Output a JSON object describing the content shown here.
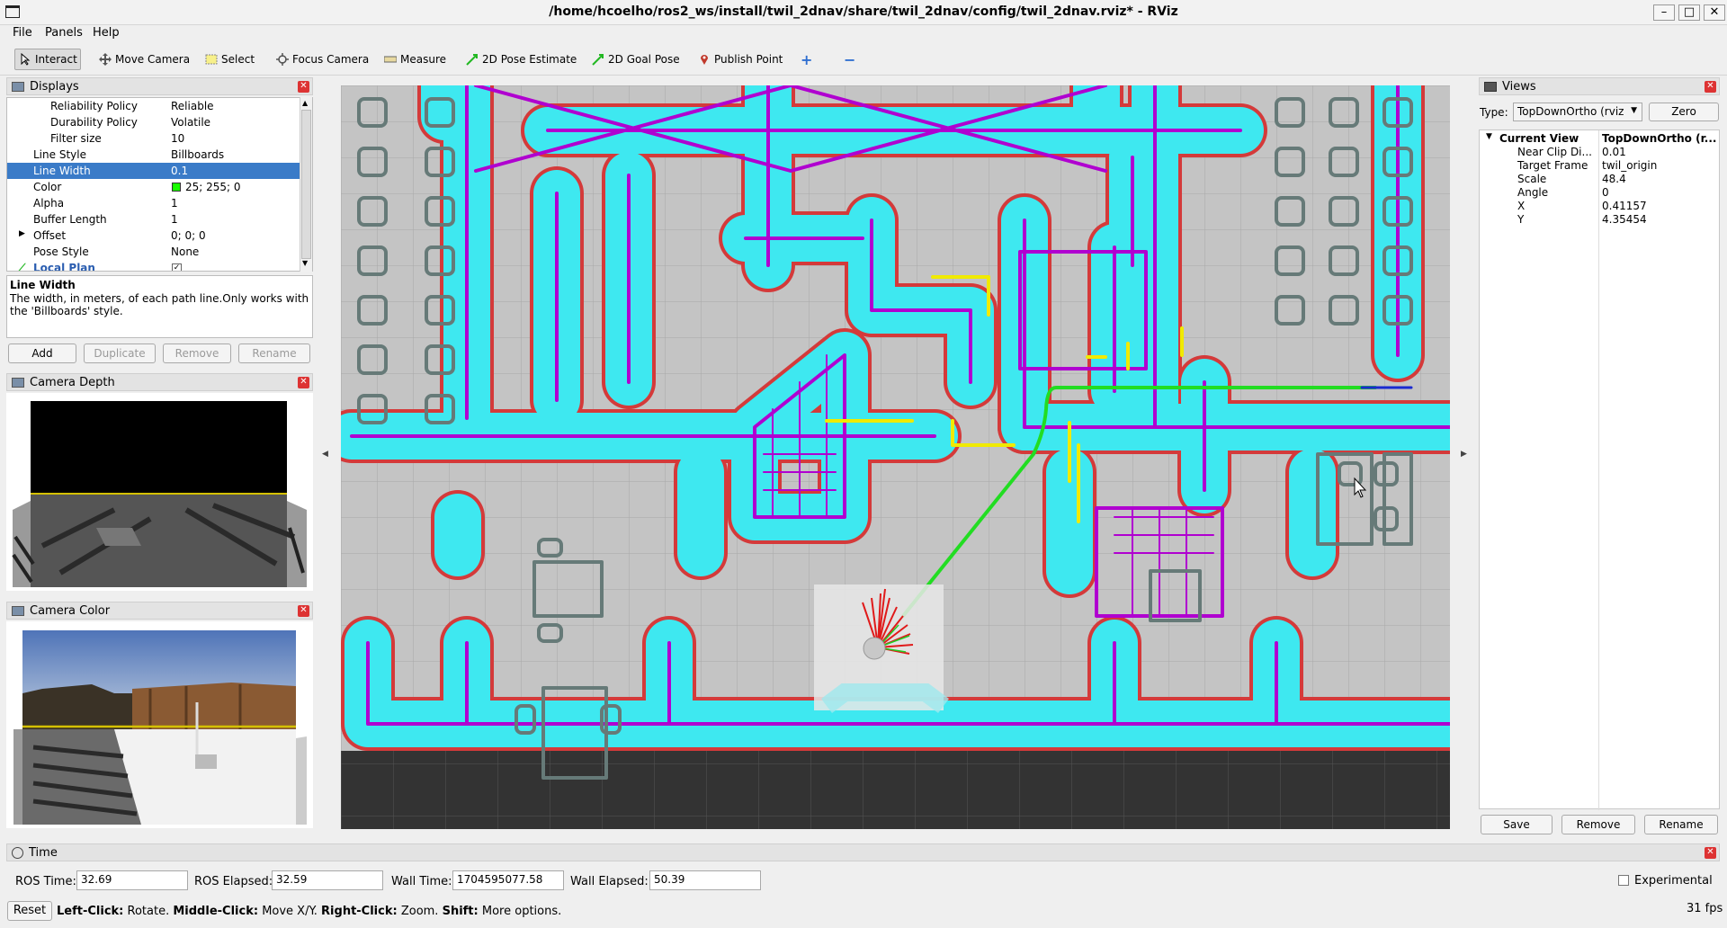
{
  "window": {
    "title": "/home/hcoelho/ros2_ws/install/twil_2dnav/share/twil_2dnav/config/twil_2dnav.rviz* - RViz"
  },
  "menu": [
    "File",
    "Panels",
    "Help"
  ],
  "toolbar": {
    "interact": "Interact",
    "move_camera": "Move Camera",
    "select": "Select",
    "focus_camera": "Focus Camera",
    "measure": "Measure",
    "pose_estimate": "2D Pose Estimate",
    "goal_pose": "2D Goal Pose",
    "publish_point": "Publish Point"
  },
  "displays": {
    "title": "Displays",
    "rows": [
      {
        "key": "Reliability Policy",
        "value": "Reliable"
      },
      {
        "key": "Durability Policy",
        "value": "Volatile"
      },
      {
        "key": "Filter size",
        "value": "10"
      },
      {
        "key": "Line Style",
        "value": "Billboards"
      },
      {
        "key": "Line Width",
        "value": "0.1"
      },
      {
        "key": "Color",
        "value": "25; 255; 0"
      },
      {
        "key": "Alpha",
        "value": "1"
      },
      {
        "key": "Buffer Length",
        "value": "1"
      },
      {
        "key": "Offset",
        "value": "0; 0; 0"
      },
      {
        "key": "Pose Style",
        "value": "None"
      },
      {
        "key": "Local Plan",
        "value": ""
      }
    ],
    "color_swatch": "#19ff00",
    "desc_title": "Line Width",
    "desc_text": "The width, in meters, of each path line.Only works with the 'Billboards' style.",
    "buttons": {
      "add": "Add",
      "duplicate": "Duplicate",
      "remove": "Remove",
      "rename": "Rename"
    }
  },
  "camera_depth": {
    "title": "Camera Depth"
  },
  "camera_color": {
    "title": "Camera Color"
  },
  "views": {
    "title": "Views",
    "type_label": "Type:",
    "type_value": "TopDownOrtho (rviz",
    "zero": "Zero",
    "current_view_label": "Current View",
    "current_view_value": "TopDownOrtho (r...",
    "rows": [
      {
        "key": "Near Clip Di...",
        "value": "0.01"
      },
      {
        "key": "Target Frame",
        "value": "twil_origin"
      },
      {
        "key": "Scale",
        "value": "48.4"
      },
      {
        "key": "Angle",
        "value": "0"
      },
      {
        "key": "X",
        "value": "0.41157"
      },
      {
        "key": "Y",
        "value": "4.35454"
      }
    ],
    "buttons": {
      "save": "Save",
      "remove": "Remove",
      "rename": "Rename"
    }
  },
  "time": {
    "title": "Time",
    "ros_time_label": "ROS Time:",
    "ros_time": "32.69",
    "ros_elapsed_label": "ROS Elapsed:",
    "ros_elapsed": "32.59",
    "wall_time_label": "Wall Time:",
    "wall_time": "1704595077.58",
    "wall_elapsed_label": "Wall Elapsed:",
    "wall_elapsed": "50.39",
    "experimental": "Experimental"
  },
  "status": {
    "reset": "Reset",
    "left_click": "Left-Click:",
    "left_action": "Rotate.",
    "middle_click": "Middle-Click:",
    "middle_action": "Move X/Y.",
    "right_click": "Right-Click:",
    "right_action": "Zoom.",
    "shift": "Shift:",
    "shift_action": "More options.",
    "fps": "31 fps"
  },
  "colors": {
    "costmap": "#3ee8f0",
    "walls": "#b000d0",
    "path": "#22dd22",
    "selection": "#3a7bc8"
  }
}
